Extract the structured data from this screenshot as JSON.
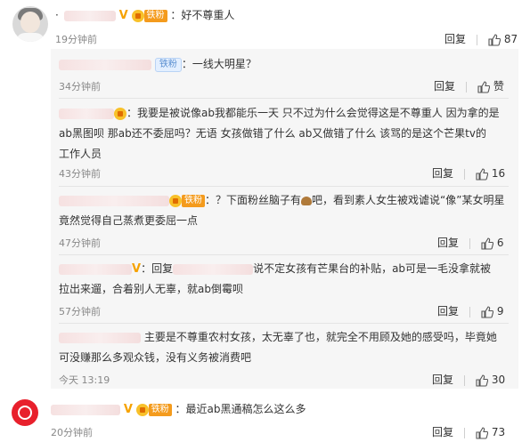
{
  "main_comment": {
    "username": "",
    "verified_mark": "V",
    "fan_badge": "铁粉",
    "text": "：好不尊重人",
    "time": "19分钟前",
    "reply_label": "回复",
    "like_count": "87"
  },
  "replies": [
    {
      "badge": "铁粉",
      "text": "：一线大明星？",
      "time": "34分钟前",
      "reply_label": "回复",
      "like_label": "赞"
    },
    {
      "line1": "：我要是被说像ab我都能乐一天  只不过为什么会觉得这是不尊重人  因为拿的是",
      "line2": "ab黑图呗  那ab还不委屈吗？无语  女孩做错了什么  ab又做错了什么  该骂的是这个芒果tv的",
      "line3": "工作人员",
      "time": "43分钟前",
      "reply_label": "回复",
      "like_count": "16"
    },
    {
      "badge": "铁粉",
      "line1a": "：？下面粉丝脑子有",
      "line1b": "吧，看到素人女生被戏谑说“像”某女明星",
      "line2": "竟然觉得自己蒸煮更委屈一点",
      "time": "47分钟前",
      "reply_label": "回复",
      "like_count": "6"
    },
    {
      "verified_mark": "V",
      "prefix": "：回复",
      "line1": "说不定女孩有芒果台的补贴，ab可是一毛没拿就被",
      "line2": "拉出来遛，合着别人无辜，就ab倒霉呗",
      "time": "57分钟前",
      "reply_label": "回复",
      "like_count": "9"
    },
    {
      "line1": "主要是不尊重农村女孩，太无辜了也，就完全不用顾及她的感受吗，毕竟她",
      "line2": "可没赚那么多观众钱，没有义务被消费吧",
      "time": "今天 13:19",
      "reply_label": "回复",
      "like_count": "30"
    }
  ],
  "bottom_comment": {
    "verified_mark": "V",
    "fan_badge": "铁粉",
    "text": "：最近ab黑通稿怎么这么多",
    "time": "20分钟前",
    "reply_label": "回复",
    "like_count": "73"
  },
  "colors": {
    "accent_fan": "#f49b1d",
    "verified": "#f6a200",
    "sub_bg": "#f6f6f6"
  }
}
